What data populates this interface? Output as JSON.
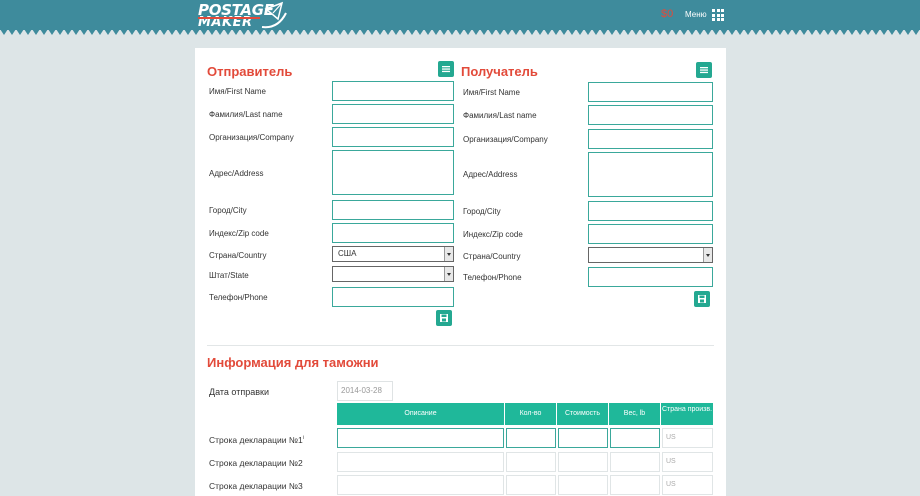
{
  "header": {
    "logo_line1": "POSTAGE",
    "logo_line2": "MAKER",
    "price": "$0",
    "menu_label": "Меню",
    "accent": "#3e8b9c",
    "brand_red": "#e24a3a"
  },
  "sender": {
    "title": "Отправитель",
    "fields": [
      {
        "label": "Имя/First Name",
        "value": ""
      },
      {
        "label": "Фамилия/Last name",
        "value": ""
      },
      {
        "label": "Организация/Company",
        "value": ""
      },
      {
        "label": "Адрес/Address",
        "value": ""
      },
      {
        "label": "Город/City",
        "value": ""
      },
      {
        "label": "Индекс/Zip code",
        "value": ""
      },
      {
        "label": "Страна/Country",
        "value": "США"
      },
      {
        "label": "Штат/State",
        "value": ""
      },
      {
        "label": "Телефон/Phone",
        "value": ""
      }
    ]
  },
  "recipient": {
    "title": "Получатель",
    "fields": [
      {
        "label": "Имя/First Name",
        "value": ""
      },
      {
        "label": "Фамилия/Last name",
        "value": ""
      },
      {
        "label": "Организация/Company",
        "value": ""
      },
      {
        "label": "Адрес/Address",
        "value": ""
      },
      {
        "label": "Город/City",
        "value": ""
      },
      {
        "label": "Индекс/Zip code",
        "value": ""
      },
      {
        "label": "Страна/Country",
        "value": ""
      },
      {
        "label": "Телефон/Phone",
        "value": ""
      }
    ]
  },
  "customs": {
    "title": "Информация для таможни",
    "date_label": "Дата отправки",
    "date_value": "2014-03-28",
    "columns": [
      "Описание",
      "Кол-во",
      "Стоимость",
      "Вес, lb",
      "Страна произв."
    ],
    "rows": [
      {
        "label": "Строка декларации №1",
        "sup": "i",
        "country": "US"
      },
      {
        "label": "Строка декларации №2",
        "country": "US"
      },
      {
        "label": "Строка декларации №3",
        "country": "US"
      }
    ]
  },
  "colors": {
    "table_header": "#1fb89a",
    "button": "#24a891",
    "input_border": "#3aa89b"
  }
}
